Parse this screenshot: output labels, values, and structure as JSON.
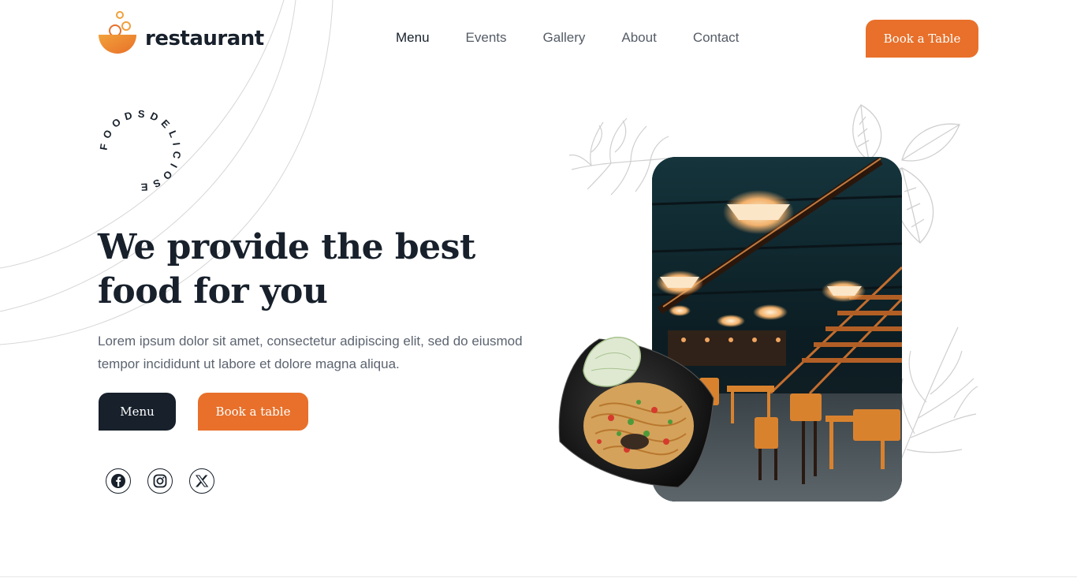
{
  "brand": {
    "name": "restaurant",
    "accent_color": "#e8702a",
    "dark_color": "#17202b"
  },
  "nav": {
    "items": [
      {
        "label": "Menu",
        "active": true
      },
      {
        "label": "Events",
        "active": false
      },
      {
        "label": "Gallery",
        "active": false
      },
      {
        "label": "About",
        "active": false
      },
      {
        "label": "Contact",
        "active": false
      }
    ],
    "cta_label": "Book a Table"
  },
  "badge": {
    "text": "FOODSDELICIOSE"
  },
  "hero": {
    "title_line1": "We provide the best",
    "title_line2": "food for you",
    "description": "Lorem ipsum dolor sit amet, consectetur adipiscing elit, sed do eiusmod tempor incididunt ut labore et dolore magna aliqua.",
    "menu_button": "Menu",
    "book_button": "Book a table"
  },
  "socials": [
    {
      "icon": "facebook-icon"
    },
    {
      "icon": "instagram-icon"
    },
    {
      "icon": "x-twitter-icon"
    }
  ],
  "images": {
    "interior": "restaurant-interior-photo",
    "dish": "noodle-salad-plate"
  }
}
